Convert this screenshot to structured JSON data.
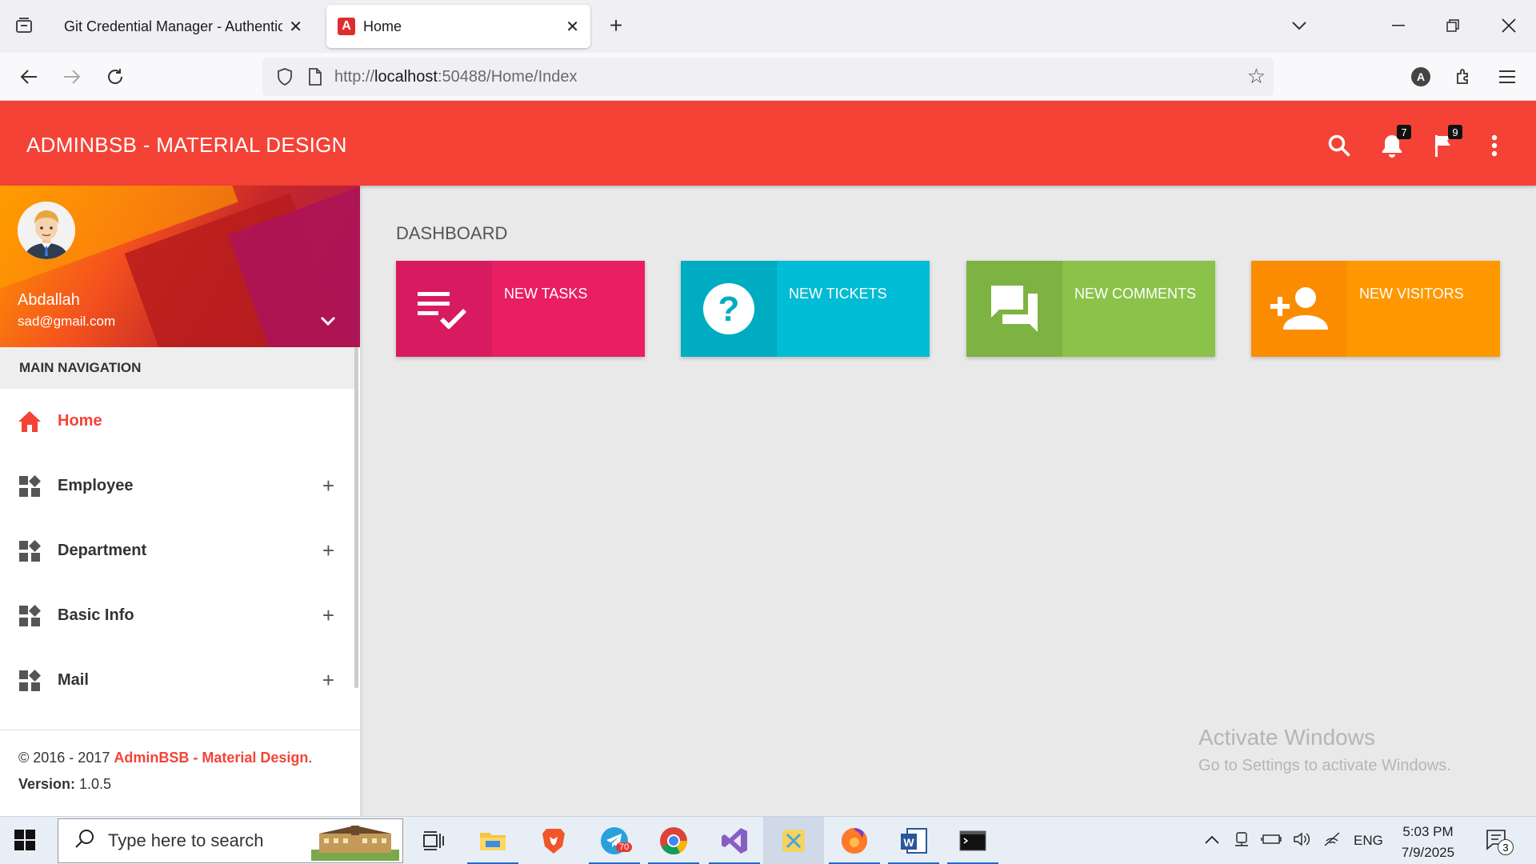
{
  "browser": {
    "tabs": [
      {
        "title": "Git Credential Manager - Authentica",
        "active": false
      },
      {
        "title": "Home",
        "active": true
      }
    ],
    "url_prefix": "http://",
    "url_host": "localhost",
    "url_rest": ":50488/Home/Index"
  },
  "header": {
    "brand": "ADMINBSB - MATERIAL DESIGN",
    "notifications_count": "7",
    "tasks_count": "9"
  },
  "user": {
    "name": "Abdallah",
    "email": "sad@gmail.com"
  },
  "sidebar": {
    "section_title": "MAIN NAVIGATION",
    "items": [
      {
        "label": "Home",
        "icon": "home-icon",
        "active": true
      },
      {
        "label": "Employee",
        "icon": "widgets-icon"
      },
      {
        "label": "Department",
        "icon": "widgets-icon"
      },
      {
        "label": "Basic Info",
        "icon": "widgets-icon"
      },
      {
        "label": "Mail",
        "icon": "widgets-icon"
      }
    ],
    "footer": {
      "copyright_prefix": "© 2016 - 2017 ",
      "copyright_link": "AdminBSB - Material Design",
      "copyright_suffix": ".",
      "version_label": "Version:",
      "version_value": " 1.0.5"
    }
  },
  "dashboard": {
    "title": "DASHBOARD",
    "cards": [
      {
        "label": "NEW TASKS",
        "icon": "playlist-check-icon",
        "color": "#e91e63",
        "icon_bg": "#d81b60"
      },
      {
        "label": "NEW TICKETS",
        "icon": "help-icon",
        "color": "#00bcd4",
        "icon_bg": "#00acc1"
      },
      {
        "label": "NEW COMMENTS",
        "icon": "forum-icon",
        "color": "#8bc34a",
        "icon_bg": "#7cb342"
      },
      {
        "label": "NEW VISITORS",
        "icon": "person-add-icon",
        "color": "#ff9800",
        "icon_bg": "#fb8c00"
      }
    ]
  },
  "watermark": {
    "line1": "Activate Windows",
    "line2": "Go to Settings to activate Windows."
  },
  "taskbar": {
    "search_placeholder": "Type here to search",
    "telegram_badge": "70",
    "language": "ENG",
    "time": "5:03 PM",
    "date": "7/9/2025",
    "notification_count": "3"
  },
  "colors": {
    "header": "#f44336",
    "active_menu": "#f44336"
  }
}
